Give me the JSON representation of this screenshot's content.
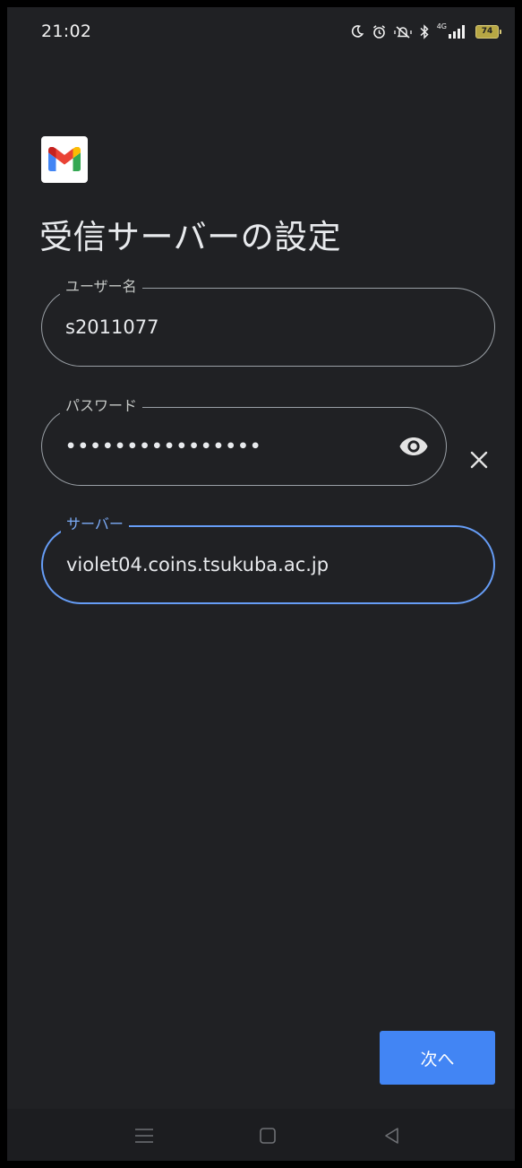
{
  "status_bar": {
    "time": "21:02",
    "network_label": "4G",
    "battery_level": "74",
    "icons": [
      "moon-icon",
      "alarm-icon",
      "vibrate-icon",
      "bluetooth-icon",
      "signal-icon",
      "battery-icon"
    ]
  },
  "app": {
    "logo": "gmail-logo",
    "colors": {
      "background": "#202124",
      "accent": "#4285f4",
      "focus_outline": "#669df6",
      "outline": "#9aa0a6"
    }
  },
  "page": {
    "title": "受信サーバーの設定"
  },
  "form": {
    "username": {
      "label": "ユーザー名",
      "value": "s2011077"
    },
    "password": {
      "label": "パスワード",
      "masked_value": "••••••••••••••••",
      "toggle_icon": "eye-icon",
      "clear_icon": "close-icon"
    },
    "server": {
      "label": "サーバー",
      "value": "violet04.coins.tsukuba.ac.jp",
      "focused": true
    }
  },
  "actions": {
    "next_label": "次へ"
  },
  "nav_bar": {
    "buttons": [
      "menu-icon",
      "home-icon",
      "back-icon"
    ]
  }
}
